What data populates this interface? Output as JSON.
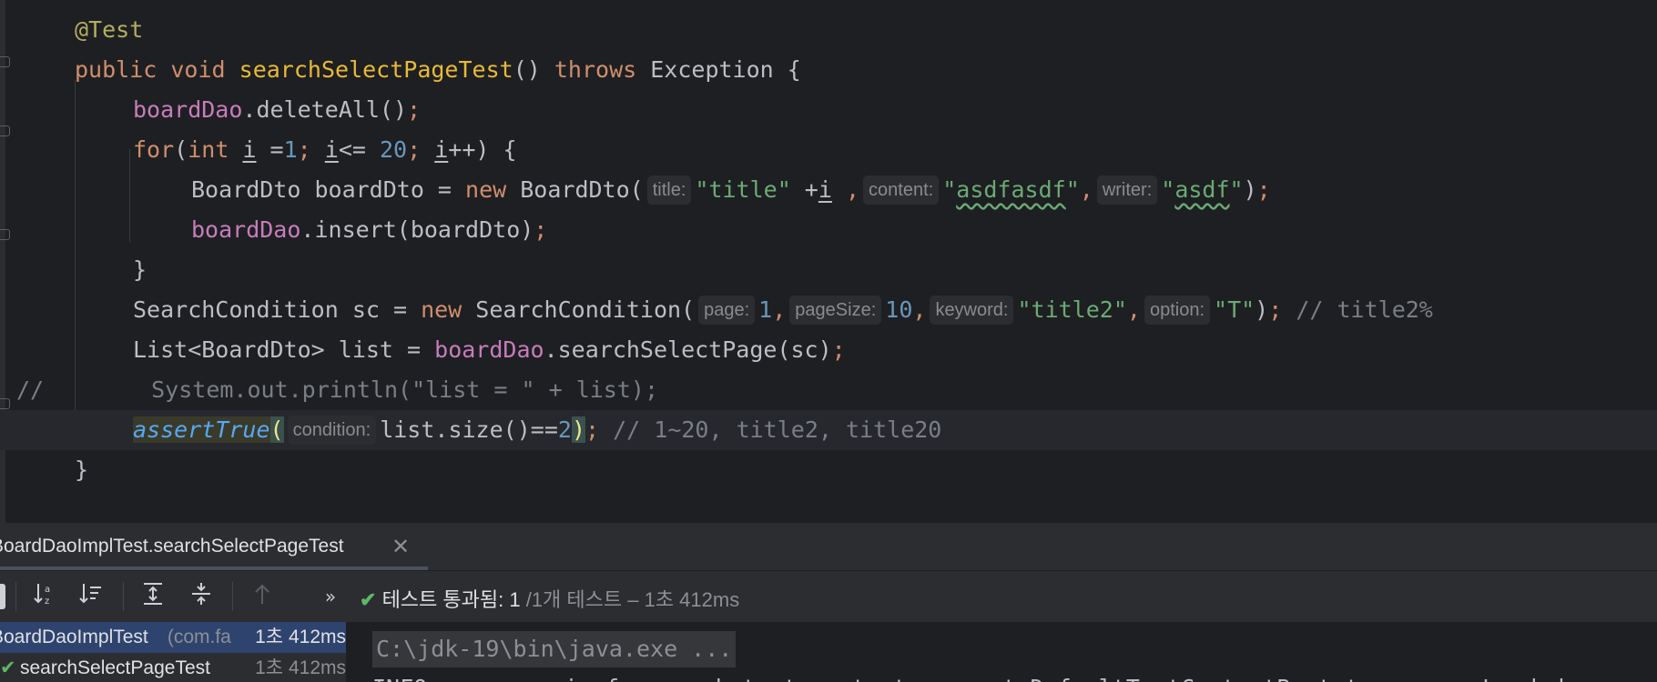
{
  "editor": {
    "lines": {
      "l1": {
        "annotation": "@Test"
      },
      "l2": {
        "kw1": "public",
        "kw2": "void",
        "method": "searchSelectPageTest",
        "paren": "()",
        "kw3": "throws",
        "exc": "Exception",
        "brace": "{"
      },
      "l3": {
        "field": "boardDao",
        "rest": ".deleteAll()",
        "semi": ";"
      },
      "l4": {
        "kw": "for",
        "p1": "(",
        "kw2": "int",
        "sp": " ",
        "v1": "i",
        "eq": " =",
        "n1": "1",
        "s1": "; ",
        "v2": "i",
        "le": "<= ",
        "n2": "20",
        "s2": "; ",
        "v3": "i",
        "inc": "++) {"
      },
      "l5": {
        "t1": "BoardDto boardDto = ",
        "kw": "new",
        "t2": " BoardDto(",
        "hint1": "title:",
        "s1": "\"title\"",
        "t3": " +",
        "v": "i",
        "t4": " ,",
        "hint2": "content:",
        "s2q1": "\"",
        "s2": "asdfasdf",
        "s2q2": "\"",
        "c2": ",",
        "hint3": "writer:",
        "s3q1": "\"",
        "s3": "asdf",
        "s3q2": "\"",
        "end": ")",
        "semi": ";"
      },
      "l6": {
        "field": "boardDao",
        "rest": ".insert(boardDto)",
        "semi": ";"
      },
      "l7": {
        "brace": "}"
      },
      "l8": {
        "t1": "SearchCondition sc = ",
        "kw": "new",
        "t2": " SearchCondition(",
        "hint1": "page:",
        "n1": "1",
        "c1": ",",
        "hint2": "pageSize:",
        "n2": "10",
        "c2": ",",
        "hint3": "keyword:",
        "s1": "\"title2\"",
        "c3": ",",
        "hint4": "option:",
        "s2": "\"T\"",
        "end": ")",
        "semi": ";",
        "comment": " // title2%"
      },
      "l9": {
        "t1": "List<BoardDto> list = ",
        "field": "boardDao",
        "rest": ".searchSelectPage(sc)",
        "semi": ";"
      },
      "l10": {
        "prefix": "//",
        "code": "System.out.println(\"list = \" + list);"
      },
      "l11": {
        "call": "assertTrue",
        "p1": "(",
        "hint": "condition:",
        "t1": "list.size()==",
        "n": "2",
        "p2": ")",
        "semi": ";",
        "comment": " // 1~20, title2, title20"
      },
      "l12": {
        "brace": "}"
      }
    }
  },
  "run_panel": {
    "tab_title": "BoardDaoImplTest.searchSelectPageTest",
    "close_icon": "✕",
    "toolbar": {
      "sort_alpha_icon": "sort-alphabetical-icon",
      "sort_duration_icon": "sort-duration-icon",
      "expand_all_icon": "expand-all-icon",
      "collapse_all_icon": "collapse-all-icon",
      "prev_failed_icon": "up-arrow-icon",
      "more": "»"
    },
    "status": {
      "label": "테스트 통과됨: ",
      "passed": "1",
      "detail": " /1개 테스트 – 1초 412ms"
    },
    "tree": [
      {
        "name": "BoardDaoImplTest",
        "pkg": " (com.fa",
        "time": "1초 412ms"
      },
      {
        "name": "searchSelectPageTest",
        "time": "1초 412ms"
      }
    ],
    "console": {
      "cmd": "C:\\jdk-19\\bin\\java.exe ...",
      "line2": "INFO : org.springframework.test.context.support.DefaultTestContextBootstrapper - Loaded"
    }
  },
  "colors": {
    "keyword": "#cf8e6d",
    "string": "#6aab73",
    "number": "#6897bb",
    "field": "#c77dbb",
    "method_decl": "#56a8f5",
    "pass_check": "#5fb865"
  }
}
